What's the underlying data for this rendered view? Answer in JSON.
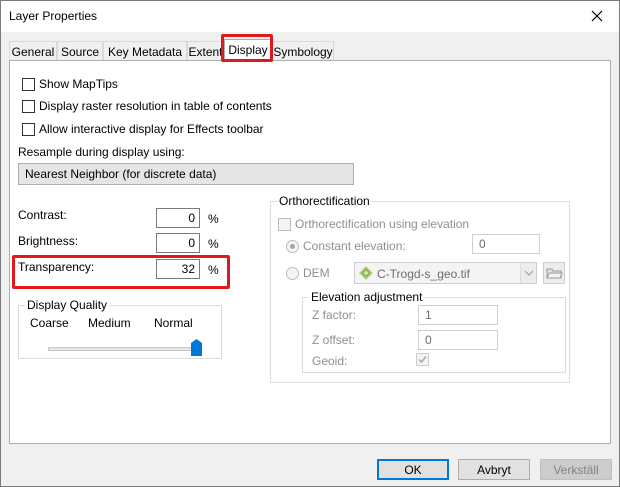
{
  "window": {
    "title": "Layer Properties"
  },
  "tabs": [
    {
      "label": "General"
    },
    {
      "label": "Source"
    },
    {
      "label": "Key Metadata"
    },
    {
      "label": "Extent"
    },
    {
      "label": "Display",
      "selected": true
    },
    {
      "label": "Symbology"
    }
  ],
  "options": {
    "show_maptips": {
      "label": "Show MapTips",
      "checked": false
    },
    "display_raster_res": {
      "label": "Display raster resolution in table of contents",
      "checked": false
    },
    "allow_interactive": {
      "label": "Allow interactive display for Effects toolbar",
      "checked": false
    }
  },
  "resample": {
    "label": "Resample during display using:",
    "value": "Nearest Neighbor (for discrete data)"
  },
  "contrast": {
    "label": "Contrast:",
    "value": "0",
    "unit": "%"
  },
  "brightness": {
    "label": "Brightness:",
    "value": "0",
    "unit": "%"
  },
  "transparency": {
    "label": "Transparency:",
    "value": "32",
    "unit": "%"
  },
  "display_quality": {
    "title": "Display Quality",
    "labels": [
      "Coarse",
      "Medium",
      "Normal"
    ],
    "value": "Normal"
  },
  "ortho": {
    "title": "Orthorectification",
    "use_elevation": {
      "label": "Orthorectification using elevation",
      "checked": false
    },
    "constant_elevation": {
      "label": "Constant elevation:",
      "value": "0",
      "selected": true
    },
    "dem": {
      "label": "DEM",
      "value": "C-Trogd-s_geo.tif",
      "selected": false
    },
    "elevation_adjustment": {
      "title": "Elevation adjustment",
      "z_factor": {
        "label": "Z factor:",
        "value": "1"
      },
      "z_offset": {
        "label": "Z offset:",
        "value": "0"
      },
      "geoid": {
        "label": "Geoid:",
        "checked": true
      }
    }
  },
  "buttons": {
    "ok": "OK",
    "cancel": "Avbryt",
    "apply": "Verkställ"
  },
  "colors": {
    "highlight": "#e0191e",
    "focus": "#0078d7",
    "slider_thumb": "#0078d7"
  }
}
